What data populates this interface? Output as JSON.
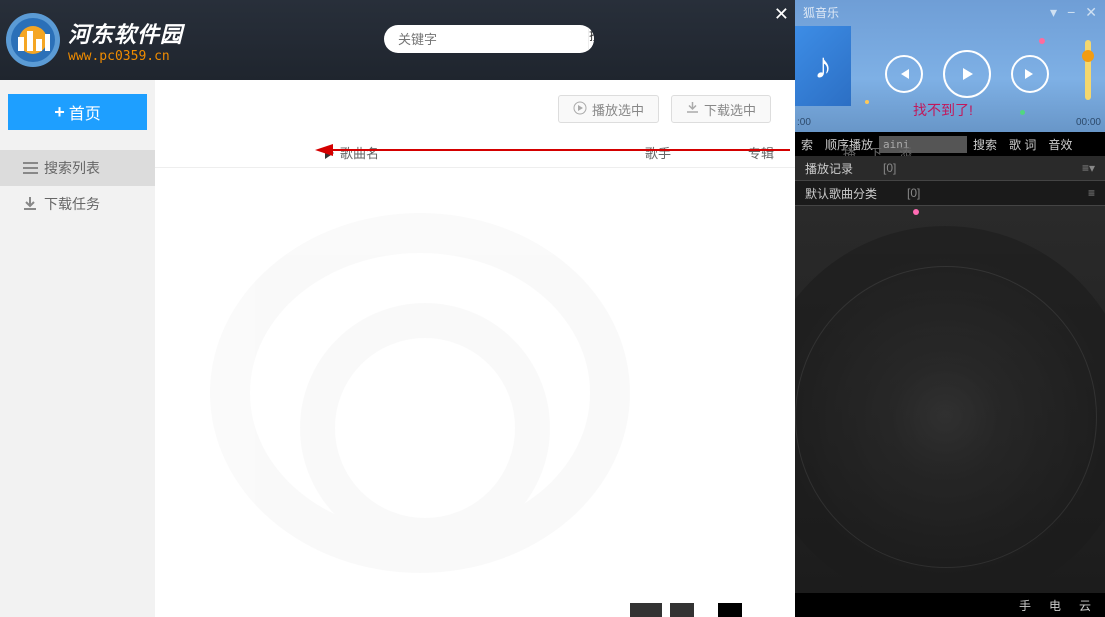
{
  "logo": {
    "title": "河东软件园",
    "url": "www.pc0359.cn"
  },
  "search": {
    "placeholder": "关键字",
    "button": "搜索"
  },
  "sidebar": {
    "home": "首页",
    "search_list": "搜索列表",
    "download_tasks": "下载任务"
  },
  "toolbar": {
    "play_selected": "播放选中",
    "download_selected": "下载选中"
  },
  "table_headers": {
    "song": "歌曲名",
    "artist": "歌手",
    "album": "专辑",
    "play": "播",
    "down": "下",
    "add": "添"
  },
  "player": {
    "app_title": "狐音乐",
    "not_found": "找不到了!",
    "time_left": ":00",
    "time_right": "00:00",
    "menu": {
      "search": "索",
      "play_mode": "顺序播放",
      "input_value": "aini",
      "search_btn": "搜索",
      "lyrics": "歌 词",
      "effects": "音效"
    },
    "playlist": {
      "history_label": "播放记录",
      "history_count": "[0]",
      "default_label": "默认歌曲分类",
      "default_count": "[0]"
    },
    "bottom": {
      "hand": "手",
      "power": "电",
      "cloud": "云"
    }
  }
}
